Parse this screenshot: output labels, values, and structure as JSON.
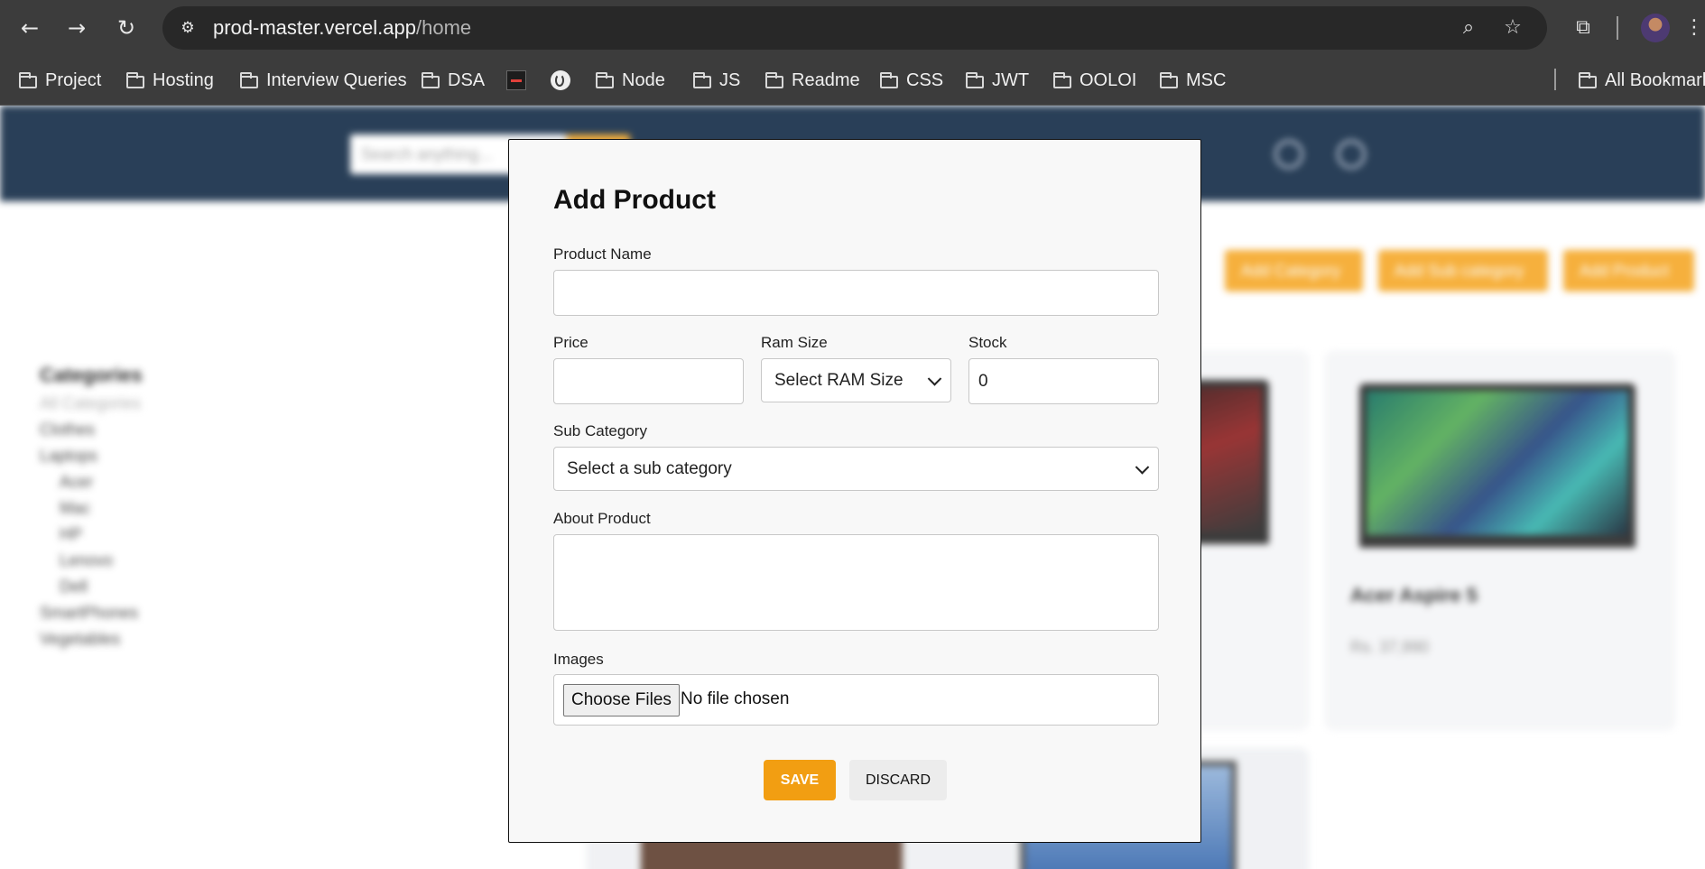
{
  "browser": {
    "url_host": "prod-master.vercel.app",
    "url_path": "/home"
  },
  "bookmarks": [
    {
      "label": "Project",
      "icon": "folder-icon"
    },
    {
      "label": "Hosting",
      "icon": "folder-icon"
    },
    {
      "label": "Interview Queries",
      "icon": "folder-icon"
    },
    {
      "label": "DSA",
      "icon": "folder-icon"
    },
    {
      "label": "",
      "icon": "site-favicon"
    },
    {
      "label": "",
      "icon": "globe-icon"
    },
    {
      "label": "Node",
      "icon": "folder-icon"
    },
    {
      "label": "JS",
      "icon": "folder-icon"
    },
    {
      "label": "Readme",
      "icon": "folder-icon"
    },
    {
      "label": "CSS",
      "icon": "folder-icon"
    },
    {
      "label": "JWT",
      "icon": "folder-icon"
    },
    {
      "label": "OOLOI",
      "icon": "folder-icon"
    },
    {
      "label": "MSC",
      "icon": "folder-icon"
    }
  ],
  "all_bookmarks_label": "All Bookmarks",
  "background_page": {
    "search_placeholder": "Search anything...",
    "actions": [
      "Add Category",
      "Add Sub category",
      "Add Product"
    ],
    "sidebar": {
      "title": "Categories",
      "all": "All Categories",
      "items": [
        "Clothes",
        "Laptops"
      ],
      "sub_items": [
        "Acer",
        "Mac",
        "HP",
        "Lenovo",
        "Dell"
      ],
      "items_after": [
        "SmartPhones",
        "Vegetables"
      ]
    },
    "product": {
      "name": "Acer Aspire 5",
      "price": "Rs. 37,990"
    }
  },
  "modal": {
    "title": "Add Product",
    "product_name_label": "Product Name",
    "product_name_value": "",
    "price_label": "Price",
    "price_value": "",
    "ram_label": "Ram Size",
    "ram_selected": "Select RAM Size",
    "stock_label": "Stock",
    "stock_value": "0",
    "subcategory_label": "Sub Category",
    "subcategory_selected": "Select a sub category",
    "about_label": "About Product",
    "about_value": "",
    "images_label": "Images",
    "choose_files": "Choose Files",
    "no_file": "No file chosen",
    "save": "SAVE",
    "discard": "DISCARD"
  },
  "colors": {
    "accent": "#f29e12",
    "navbar": "#0c2541",
    "chrome": "#3c3c3c"
  }
}
